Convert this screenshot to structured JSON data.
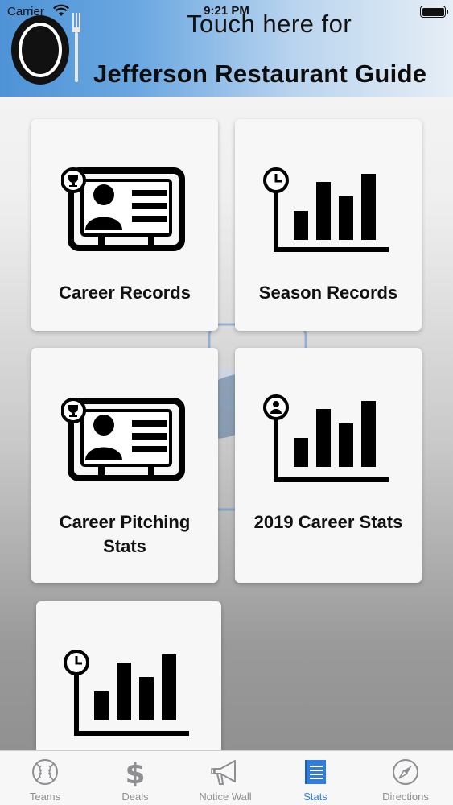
{
  "status_bar": {
    "carrier": "Carrier",
    "time": "9:21 PM"
  },
  "banner": {
    "line1": "Touch here for",
    "line2": "Jefferson Restaurant Guide"
  },
  "tiles": [
    {
      "label": "Career Records",
      "icon": "id-card-trophy-icon"
    },
    {
      "label": "Season Records",
      "icon": "bar-chart-clock-icon"
    },
    {
      "label_lines": [
        "Career Pitching",
        "Stats"
      ],
      "icon": "id-card-trophy-icon"
    },
    {
      "label": "2019 Career Stats",
      "icon": "bar-chart-person-icon"
    },
    {
      "label": "",
      "icon": "bar-chart-clock-icon"
    }
  ],
  "tabs": [
    {
      "label": "Teams",
      "icon": "baseball-icon"
    },
    {
      "label": "Deals",
      "icon": "dollar-icon"
    },
    {
      "label": "Notice Wall",
      "icon": "megaphone-icon"
    },
    {
      "label": "Stats",
      "icon": "document-icon",
      "active": true
    },
    {
      "label": "Directions",
      "icon": "compass-icon"
    }
  ],
  "colors": {
    "accent": "#2f7de1",
    "tab_inactive": "#8e8e93",
    "banner_blue": "#4e93d6"
  }
}
